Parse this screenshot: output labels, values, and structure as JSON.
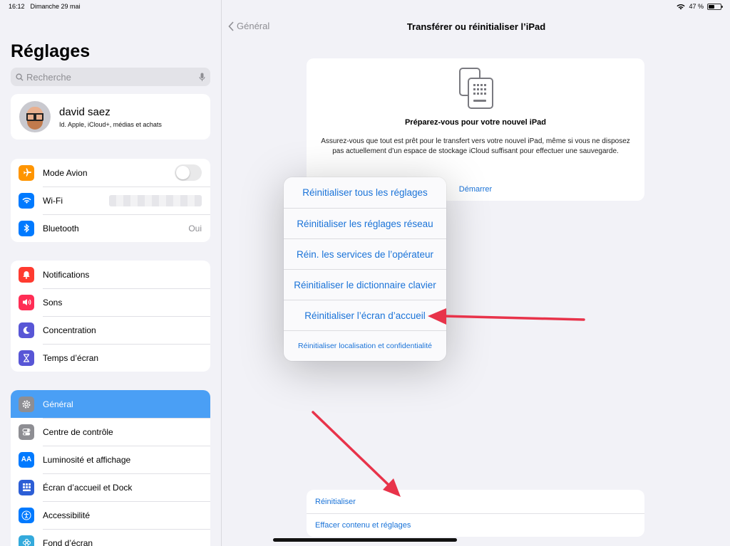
{
  "status_bar": {
    "time": "16:12",
    "date": "Dimanche 29 mai",
    "battery": "47 %"
  },
  "sidebar": {
    "title": "Réglages",
    "search_placeholder": "Recherche",
    "profile": {
      "name": "david saez",
      "subtitle": "Id. Apple, iCloud+, médias et achats"
    },
    "group1": [
      {
        "label": "Mode Avion",
        "icon": "airplane-icon",
        "color": "#ff9500"
      },
      {
        "label": "Wi-Fi",
        "icon": "wifi-icon",
        "color": "#007aff"
      },
      {
        "label": "Bluetooth",
        "icon": "bluetooth-icon",
        "color": "#007aff",
        "value": "Oui"
      }
    ],
    "group2": [
      {
        "label": "Notifications",
        "icon": "bell-icon",
        "color": "#ff3b30"
      },
      {
        "label": "Sons",
        "icon": "speaker-icon",
        "color": "#ff2d55"
      },
      {
        "label": "Concentration",
        "icon": "moon-icon",
        "color": "#5856d6"
      },
      {
        "label": "Temps d’écran",
        "icon": "hourglass-icon",
        "color": "#5856d6"
      }
    ],
    "group3": [
      {
        "label": "Général",
        "icon": "gear-icon",
        "color": "#8e8e93"
      },
      {
        "label": "Centre de contrôle",
        "icon": "switches-icon",
        "color": "#8e8e93"
      },
      {
        "label": "Luminosité et affichage",
        "icon": "text-size-icon",
        "color": "#007aff"
      },
      {
        "label": "Écran d’accueil et Dock",
        "icon": "grid-icon",
        "color": "#2c5ed6"
      },
      {
        "label": "Accessibilité",
        "icon": "accessibility-icon",
        "color": "#007aff"
      },
      {
        "label": "Fond d’écran",
        "icon": "flower-icon",
        "color": "#34aadc"
      }
    ]
  },
  "main": {
    "back_label": "Général",
    "title": "Transférer ou réinitialiser l’iPad",
    "card": {
      "title": "Préparez-vous pour votre nouvel iPad",
      "text": "Assurez-vous que tout est prêt pour le transfert vers votre nouvel iPad, même si vous ne disposez pas actuellement d’un espace de stockage iCloud suffisant pour effectuer une sauvegarde.",
      "link": "Démarrer"
    },
    "bottom": {
      "reset": "Réinitialiser",
      "erase": "Effacer contenu et réglages"
    }
  },
  "menu": {
    "items": [
      "Réinitialiser tous les réglages",
      "Réinitialiser les réglages réseau",
      "Réin. les services de l’opérateur",
      "Réinitialiser le dictionnaire clavier",
      "Réinitialiser l’écran d’accueil",
      "Réinitialiser localisation et confidentialité"
    ]
  },
  "colors": {
    "accent": "#1a73d8",
    "selected": "#4a9ff5",
    "arrow": "#e8334a"
  }
}
